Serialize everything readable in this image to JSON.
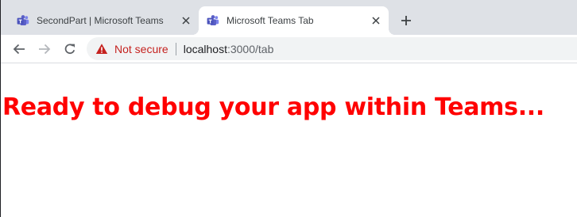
{
  "tabs": [
    {
      "title": "SecondPart | Microsoft Teams",
      "icon": "teams-icon",
      "active": false
    },
    {
      "title": "Microsoft Teams Tab",
      "icon": "teams-icon",
      "active": true
    }
  ],
  "toolbar": {
    "security_label": "Not secure",
    "url_host": "localhost",
    "url_rest": ":3000/tab"
  },
  "page": {
    "heading": "Ready to debug your app within Teams..."
  },
  "colors": {
    "heading": "#ff0000",
    "teams_brand": "#5b5fc7",
    "not_secure": "#c5221f"
  }
}
